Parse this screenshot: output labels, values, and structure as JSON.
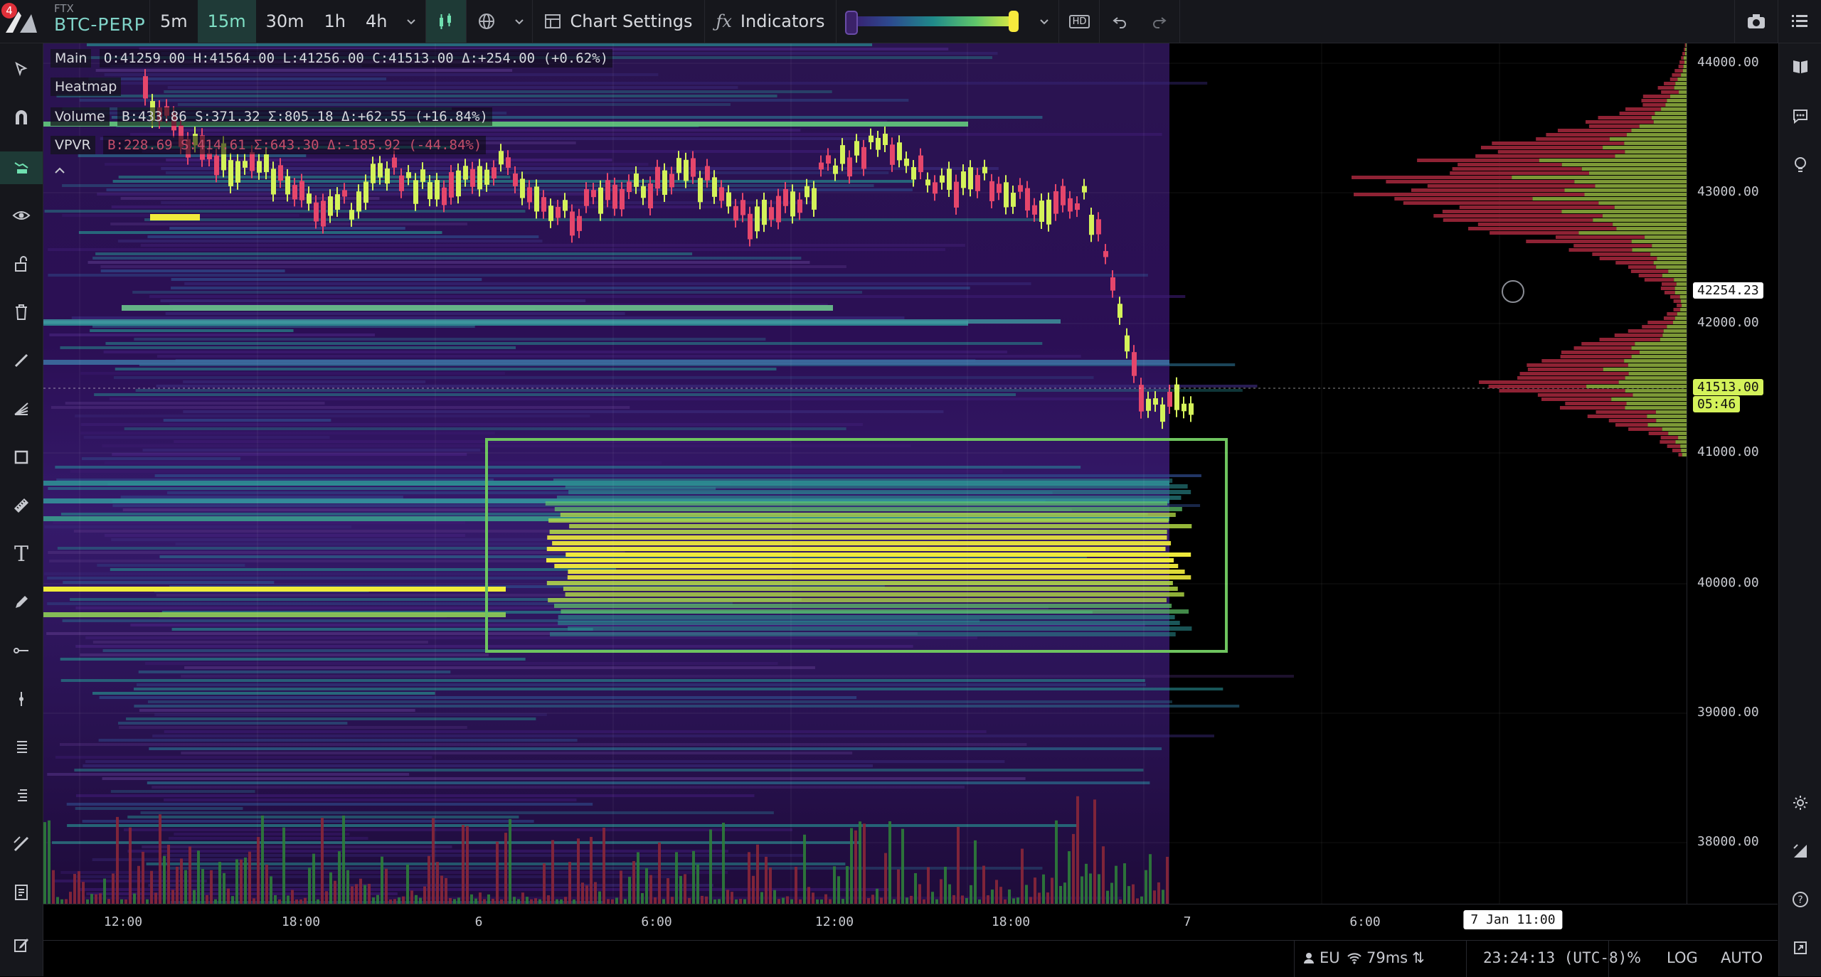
{
  "notification_count": "4",
  "symbol": {
    "exchange": "FTX",
    "name": "BTC-PERP"
  },
  "timeframes": [
    {
      "label": "5m",
      "active": false
    },
    {
      "label": "15m",
      "active": true
    },
    {
      "label": "30m",
      "active": false
    },
    {
      "label": "1h",
      "active": false
    },
    {
      "label": "4h",
      "active": false
    }
  ],
  "toolbar": {
    "chart_settings": "Chart Settings",
    "indicators": "Indicators",
    "hd": "HD"
  },
  "legend": {
    "main_label": "Main",
    "main_values": "O:41259.00 H:41564.00 L:41256.00 C:41513.00 Δ:+254.00 (+0.62%)",
    "heatmap_label": "Heatmap",
    "volume_label": "Volume",
    "volume_values": "B:433.86 S:371.32 Σ:805.18 Δ:+62.55 (+16.84%)",
    "vpvr_label": "VPVR",
    "vpvr_values": "B:228.69 S:414.61 Σ:643.30 Δ:-185.92 (-44.84%)"
  },
  "price_axis": {
    "ticks": [
      "44000.00",
      "43000.00",
      "42000.00",
      "41000.00",
      "40000.00",
      "39000.00",
      "38000.00"
    ],
    "crosshair_price": "42254.23",
    "last_price": "41513.00",
    "countdown": "05:46"
  },
  "time_axis": {
    "ticks": [
      "12:00",
      "18:00",
      "6",
      "6:00",
      "12:00",
      "18:00",
      "7",
      "6:00"
    ],
    "crosshair_time": "7 Jan 11:00"
  },
  "status": {
    "region": "EU",
    "latency": "79ms",
    "clock": "23:24:13 (UTC-8)",
    "percent": "%",
    "log": "LOG",
    "auto": "AUTO"
  },
  "colors": {
    "up_candle": "#d4f25a",
    "down_candle": "#e5466b",
    "accent": "#6fe0b0",
    "highlight_box": "#6ec45f"
  }
}
